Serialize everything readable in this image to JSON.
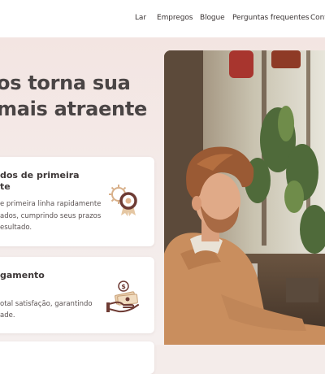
{
  "nav": {
    "items": [
      {
        "label": "Lar"
      },
      {
        "label": "Empregos"
      },
      {
        "label": "Blogue"
      },
      {
        "label": "Perguntas frequentes"
      },
      {
        "label": "Cont"
      }
    ]
  },
  "hero": {
    "headline_line1": "os torna sua",
    "headline_line2": "mais atraente"
  },
  "cards": [
    {
      "title_line1": "dos de primeira",
      "title_line2": "te",
      "text_line1": "e primeira linha rapidamente",
      "text_line2": "ados, cumprindo seus prazos",
      "text_line3": "esultado.",
      "icon": "quality-medal-gear-icon"
    },
    {
      "title_line1": "gamento",
      "text_line1": "otal satisfação, garantindo",
      "text_line2": "ade.",
      "icon": "payment-hand-money-icon"
    }
  ],
  "photo": {
    "icon": "man-working-on-laptop-photo"
  },
  "colors": {
    "accent": "#6e3b34",
    "background": "#f4ecea",
    "text": "#3b3636"
  }
}
